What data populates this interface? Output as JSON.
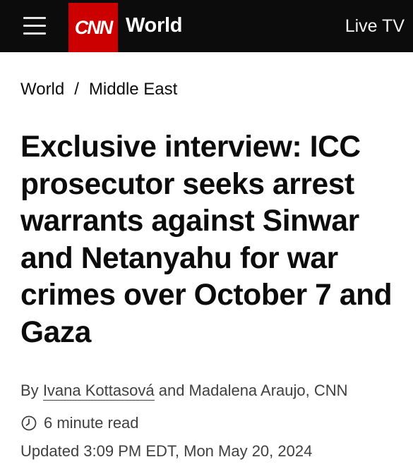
{
  "header": {
    "logo_text": "CNN",
    "section": "World",
    "live_tv": "Live TV",
    "logo_color": "#cc0000",
    "bar_color": "#0c0c0c"
  },
  "breadcrumb": {
    "items": [
      "World",
      "Middle East"
    ],
    "separator": "/"
  },
  "article": {
    "headline": "Exclusive interview: ICC prosecutor seeks arrest warrants against Sinwar and Netanyahu for war crimes over October 7 and Gaza",
    "byline": {
      "prefix": "By",
      "author_linked": "Ivana Kottasová",
      "rest": "and Madalena Araujo, CNN"
    },
    "read_time": "6 minute read",
    "updated": "Updated 3:09 PM EDT, Mon May 20, 2024"
  },
  "icons": {
    "menu": "hamburger-menu-icon",
    "clock": "clock-icon"
  }
}
